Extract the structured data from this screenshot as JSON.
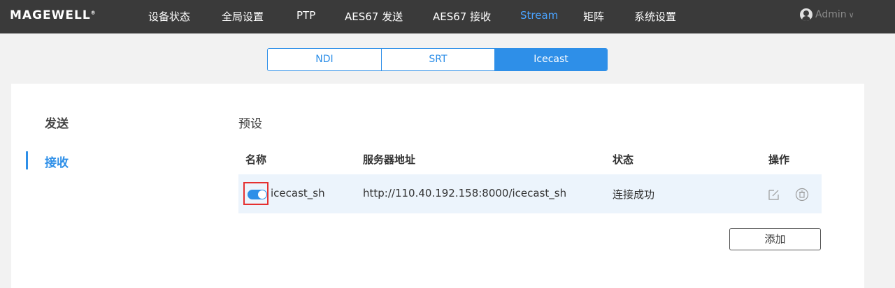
{
  "header": {
    "logo_text": "MAGEWELL",
    "logo_mark": "®",
    "nav": [
      {
        "label": "设备状态"
      },
      {
        "label": "全局设置"
      },
      {
        "label": "PTP"
      },
      {
        "label": "AES67 发送"
      },
      {
        "label": "AES67 接收"
      },
      {
        "label": "Stream"
      },
      {
        "label": "矩阵"
      },
      {
        "label": "系统设置"
      }
    ],
    "active_nav": "Stream",
    "user_label": "Admin",
    "chevron": "∨"
  },
  "tabs": [
    {
      "label": "NDI"
    },
    {
      "label": "SRT"
    },
    {
      "label": "Icecast"
    }
  ],
  "active_tab": "Icecast",
  "sidebar": {
    "items": [
      {
        "label": "发送"
      },
      {
        "label": "接收"
      }
    ],
    "active": "接收"
  },
  "preset": {
    "title": "预设",
    "columns": {
      "name": "名称",
      "server": "服务器地址",
      "status": "状态",
      "action": "操作"
    },
    "rows": [
      {
        "enabled": true,
        "name": "icecast_sh",
        "server": "http://110.40.192.158:8000/icecast_sh",
        "status": "连接成功",
        "actions": [
          "edit-icon",
          "delete-icon"
        ]
      }
    ],
    "add_label": "添加"
  },
  "colors": {
    "accent": "#2e8fe8",
    "topbar": "#3a3a3a",
    "highlight_box": "#e53030",
    "row_bg": "#ecf4fc"
  }
}
